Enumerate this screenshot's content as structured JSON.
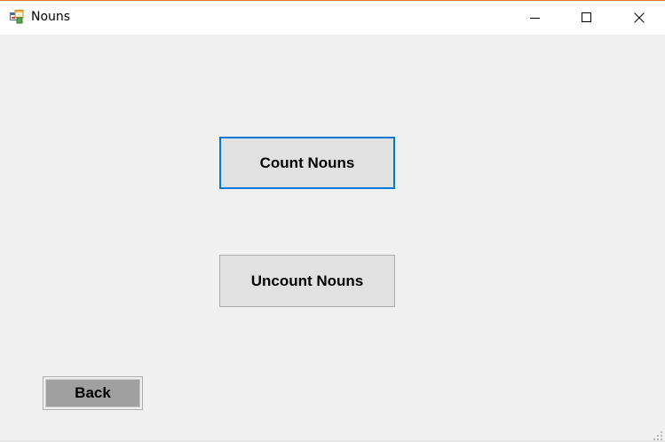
{
  "window": {
    "title": "Nouns",
    "accent_color": "#d9792b",
    "icon": "app-form-icon"
  },
  "caption_buttons": {
    "minimize_icon": "minimize-icon",
    "maximize_icon": "maximize-icon",
    "close_icon": "close-icon"
  },
  "form": {
    "count_nouns_label": "Count Nouns",
    "uncount_nouns_label": "Uncount Nouns",
    "back_label": "Back",
    "focus_color": "#0078d7",
    "button_color": "#e1e1e1",
    "back_fill_color": "#a0a0a0"
  }
}
